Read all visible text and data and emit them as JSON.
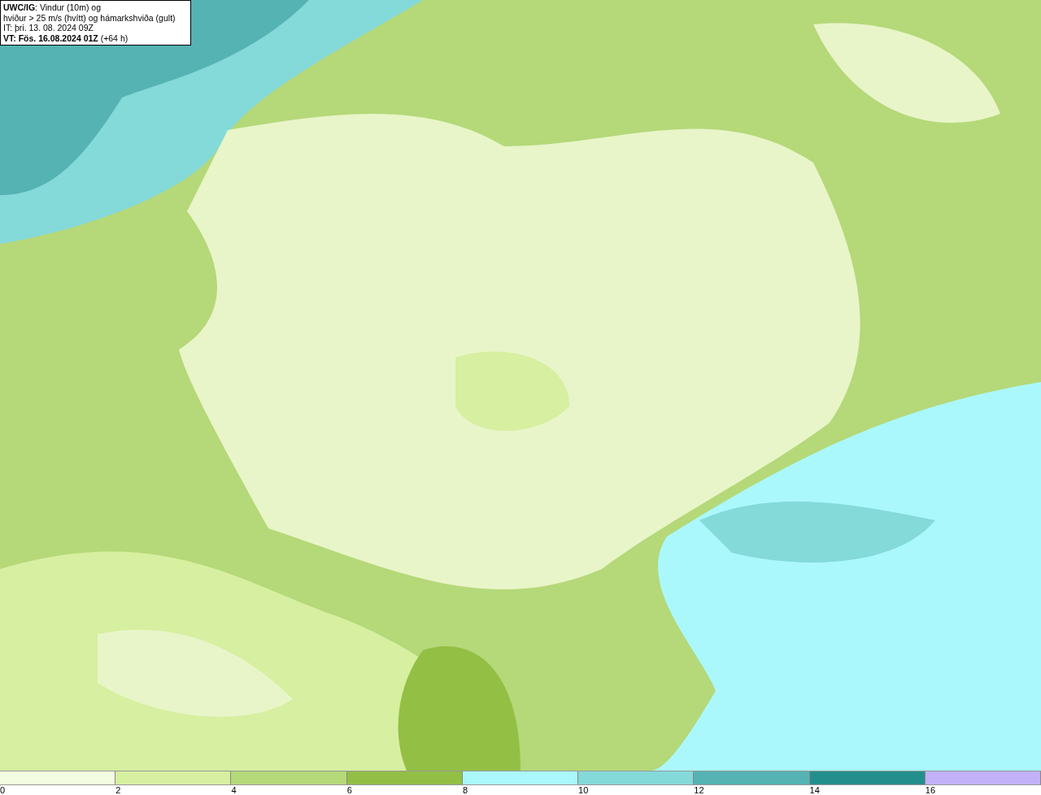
{
  "info_box": {
    "lines": [
      "**UWC/IG**: Vindur (10m) og",
      "hviður > 25 m/s (hvítt) og hámarkshviða (gult)",
      "IT: þri. 13. 08. 2024 09Z",
      "**VT: Fös. 16.08.2024 01Z** (+64 h)"
    ]
  },
  "legend": {
    "bins": [
      {
        "label": "0",
        "color": "#f3fbe0"
      },
      {
        "label": "2",
        "color": "#d6efa0"
      },
      {
        "label": "4",
        "color": "#b5d879"
      },
      {
        "label": "6",
        "color": "#93bf45"
      },
      {
        "label": "8",
        "color": "#aaf8fb"
      },
      {
        "label": "10",
        "color": "#84d9d9"
      },
      {
        "label": "12",
        "color": "#55b3b3"
      },
      {
        "label": "14",
        "color": "#238f8d"
      },
      {
        "label": "16",
        "color": "#c2b1f8"
      }
    ]
  }
}
